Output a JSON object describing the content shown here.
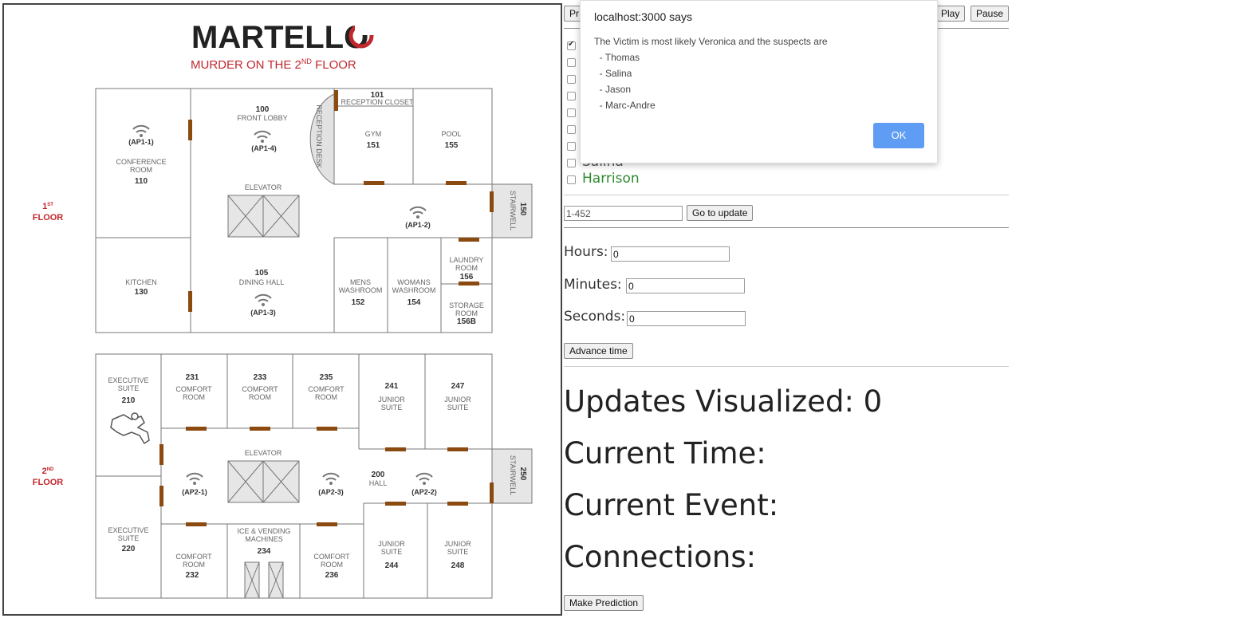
{
  "map": {
    "brand": "MARTELLO",
    "subtitle_main": "MURDER ON THE 2",
    "subtitle_sup": "ND",
    "subtitle_end": " FLOOR",
    "floor1": {
      "number": "1",
      "sup": "ST",
      "word": "FLOOR"
    },
    "floor2": {
      "number": "2",
      "sup": "ND",
      "word": "FLOOR"
    },
    "rooms": {
      "r100_num": "100",
      "r100_name": "FRONT LOBBY",
      "r101_num": "101",
      "r101_name": "RECEPTION CLOSET",
      "reception": "RECEPTION DESK",
      "r110_name1": "CONFERENCE",
      "r110_name2": "ROOM",
      "r110_num": "110",
      "r151_name": "GYM",
      "r151_num": "151",
      "r155_name": "POOL",
      "r155_num": "155",
      "r150_num": "150",
      "r150_name": "STAIRWELL",
      "elevator1": "ELEVATOR",
      "r130_name": "KITCHEN",
      "r130_num": "130",
      "r105_num": "105",
      "r105_name": "DINING HALL",
      "r152_name1": "MENS",
      "r152_name2": "WASHROOM",
      "r152_num": "152",
      "r154_name1": "WOMANS",
      "r154_name2": "WASHROOM",
      "r154_num": "154",
      "r156_name1": "LAUNDRY",
      "r156_name2": "ROOM",
      "r156_num": "156",
      "r156b_name1": "STORAGE",
      "r156b_name2": "ROOM",
      "r156b_num": "156B",
      "r210_name1": "EXECUTIVE",
      "r210_name2": "SUITE",
      "r210_num": "210",
      "r231_num": "231",
      "r231_name1": "COMFORT",
      "r231_name2": "ROOM",
      "r233_num": "233",
      "r233_name1": "COMFORT",
      "r233_name2": "ROOM",
      "r235_num": "235",
      "r235_name1": "COMFORT",
      "r235_name2": "ROOM",
      "r241_num": "241",
      "r241_name1": "JUNIOR",
      "r241_name2": "SUITE",
      "r247_num": "247",
      "r247_name1": "JUNIOR",
      "r247_name2": "SUITE",
      "elevator2": "ELEVATOR",
      "r200_num": "200",
      "r200_name": "HALL",
      "r250_num": "250",
      "r250_name": "STAIRWELL",
      "r220_name1": "EXECUTIVE",
      "r220_name2": "SUITE",
      "r220_num": "220",
      "r232_name1": "COMFORT",
      "r232_name2": "ROOM",
      "r232_num": "232",
      "r234_name1": "ICE & VENDING",
      "r234_name2": "MACHINES",
      "r234_num": "234",
      "r236_name1": "COMFORT",
      "r236_name2": "ROOM",
      "r236_num": "236",
      "r244_name1": "JUNIOR",
      "r244_name2": "SUITE",
      "r244_num": "244",
      "r248_name1": "JUNIOR",
      "r248_name2": "SUITE",
      "r248_num": "248"
    },
    "access_points": {
      "ap1_1": "(AP1-1)",
      "ap1_2": "(AP1-2)",
      "ap1_3": "(AP1-3)",
      "ap1_4": "(AP1-4)",
      "ap2_1": "(AP2-1)",
      "ap2_2": "(AP2-2)",
      "ap2_3": "(AP2-3)"
    },
    "colors": {
      "brand_red": "#c1272d",
      "door": "#8b4a0f",
      "stair_fill": "#e6e6e6"
    }
  },
  "controls": {
    "prev_label": "Pr",
    "play_label": "Play",
    "pause_label": "Pause",
    "people_visible": [
      {
        "name": "Salina",
        "checked": false,
        "color": "#555555"
      },
      {
        "name": "Harrison",
        "checked": false,
        "color": "#2e8b2e"
      }
    ],
    "first_checkbox_checked": true,
    "update_input_value": "1-452",
    "go_to_update_label": "Go to update",
    "hours_label": "Hours:",
    "hours_value": "0",
    "minutes_label": "Minutes:",
    "minutes_value": "0",
    "seconds_label": "Seconds:",
    "seconds_value": "0",
    "advance_time_label": "Advance time",
    "updates_visualized": "Updates Visualized: 0",
    "current_time": "Current Time:",
    "current_event": "Current Event:",
    "connections": "Connections:",
    "make_prediction_label": "Make Prediction"
  },
  "dialog": {
    "title": "localhost:3000 says",
    "message": "The Victim is most likely Veronica and the suspects are\n  - Thomas\n  - Salina\n  - Jason\n  - Marc-Andre",
    "ok_label": "OK"
  }
}
